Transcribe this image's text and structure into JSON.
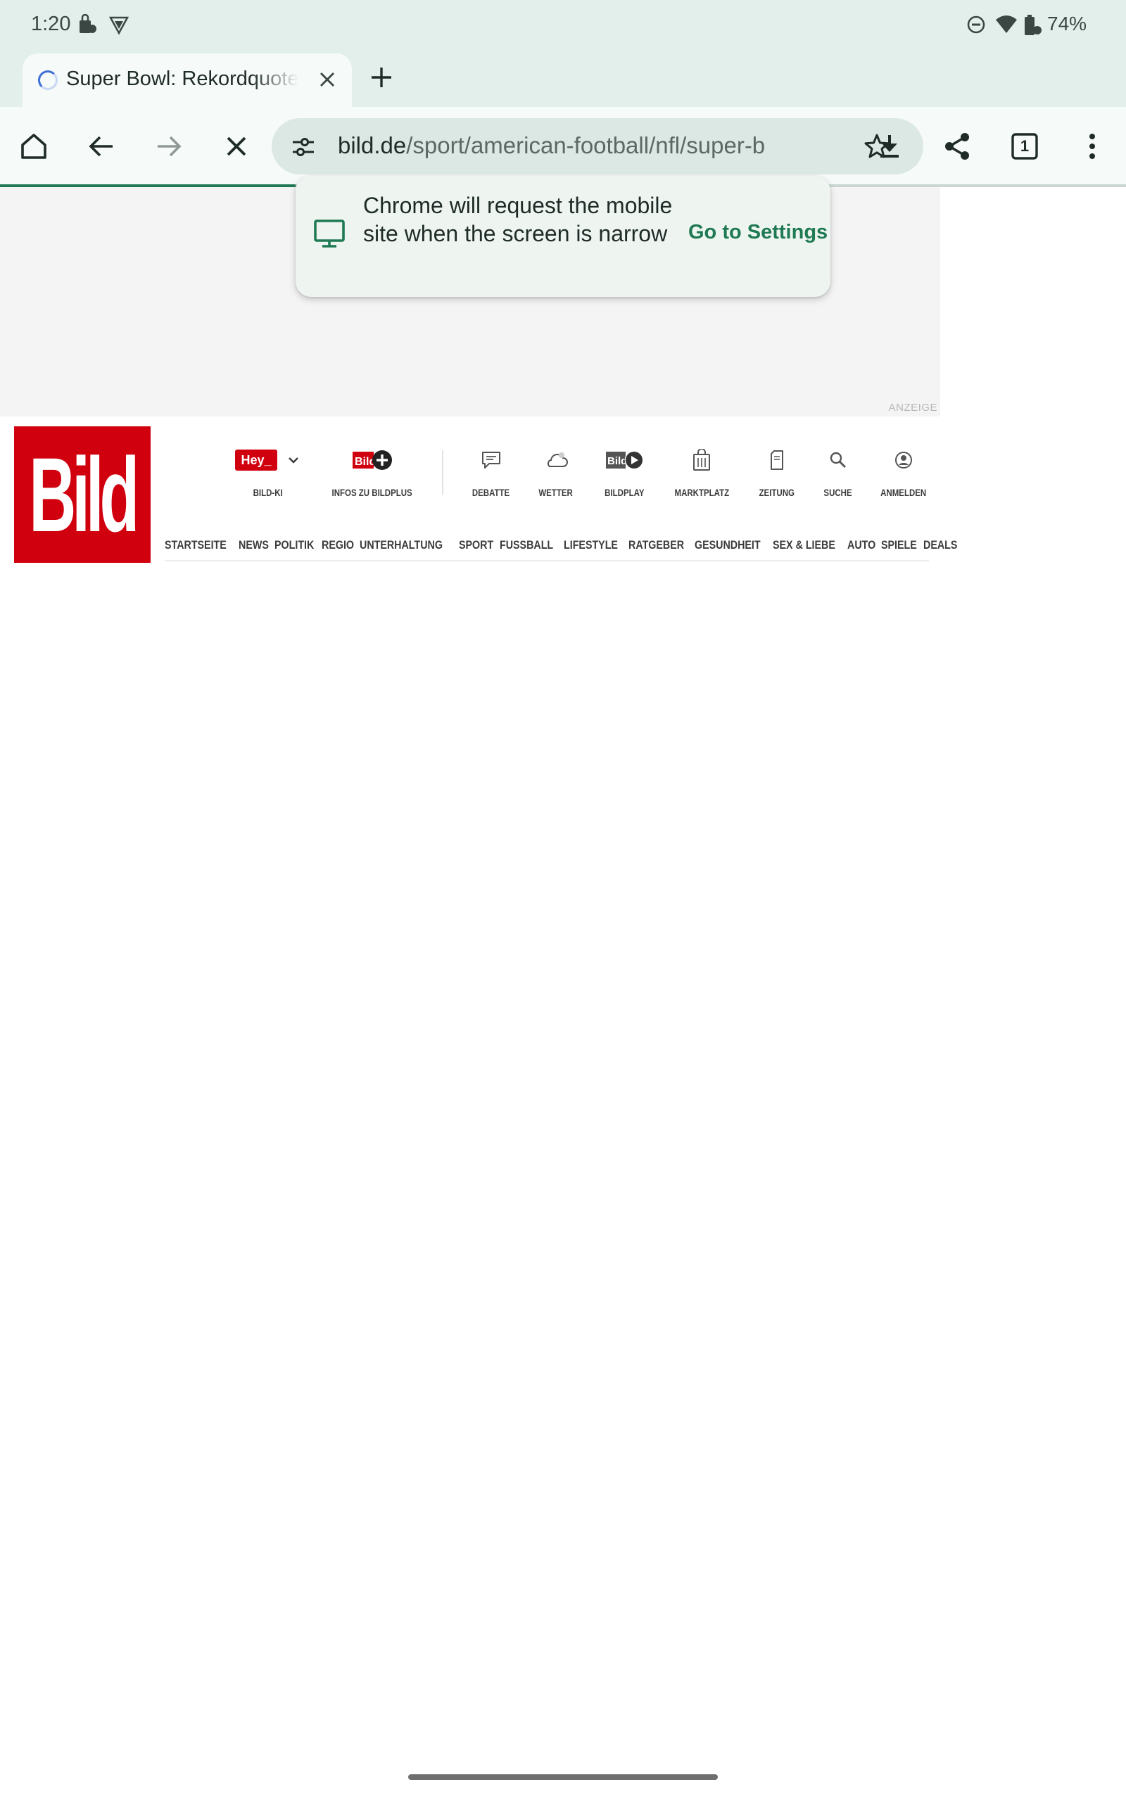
{
  "status_bar": {
    "time": "1:20",
    "battery_text": "74%",
    "icons": [
      "notification-bag-icon",
      "vpn-shield-icon",
      "do-not-disturb-icon",
      "wifi-icon",
      "battery-icon"
    ]
  },
  "tab": {
    "title": "Super Bowl: Rekordquote für",
    "close_icon": "close-icon",
    "new_tab_icon": "plus-icon"
  },
  "toolbar": {
    "url_domain": "bild.de",
    "url_path": "/sport/american-football/nfl/super-b",
    "tab_count": "1",
    "icons": [
      "home-icon",
      "back-arrow-icon",
      "forward-arrow-icon",
      "stop-loading-icon",
      "site-settings-icon",
      "bookmark-star-icon",
      "download-icon",
      "share-icon",
      "tab-switcher-icon",
      "more-menu-icon"
    ]
  },
  "popup": {
    "message": "Chrome will request the mobile site when the screen is narrow",
    "action": "Go to Settings",
    "icon": "desktop-monitor-icon"
  },
  "page": {
    "ad_label": "ANZEIGE",
    "logo_text": "Bild",
    "hey_badge": "Hey_",
    "top_nav": [
      {
        "label": "BILD-KI"
      },
      {
        "label": "INFOS ZU BILDPLUS"
      },
      {
        "label": "DEBATTE"
      },
      {
        "label": "WETTER"
      },
      {
        "label": "BILDPLAY"
      },
      {
        "label": "MARKTPLATZ"
      },
      {
        "label": "ZEITUNG"
      },
      {
        "label": "SUCHE"
      },
      {
        "label": "ANMELDEN"
      }
    ],
    "main_nav": [
      "STARTSEITE",
      "NEWS",
      "POLITIK",
      "REGIO",
      "UNTERHALTUNG",
      "SPORT",
      "FUSSBALL",
      "LIFESTYLE",
      "RATGEBER",
      "GESUNDHEIT",
      "SEX & LIEBE",
      "AUTO",
      "SPIELE",
      "DEALS"
    ]
  },
  "colors": {
    "chrome_bg": "#e3efea",
    "accent_green": "#1f7a53",
    "bild_red": "#d1000e"
  }
}
